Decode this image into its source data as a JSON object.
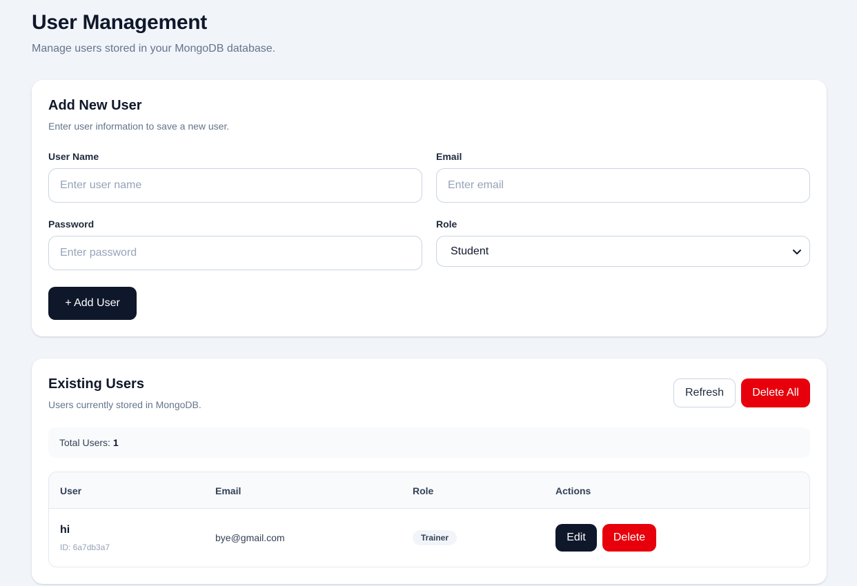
{
  "header": {
    "title": "User Management",
    "subtitle": "Manage users stored in your MongoDB database."
  },
  "add_user": {
    "title": "Add New User",
    "description": "Enter user information to save a new user.",
    "fields": {
      "username": {
        "label": "User Name",
        "placeholder": "Enter user name",
        "value": ""
      },
      "email": {
        "label": "Email",
        "placeholder": "Enter email",
        "value": ""
      },
      "password": {
        "label": "Password",
        "placeholder": "Enter password",
        "value": ""
      },
      "role": {
        "label": "Role",
        "selected": "Student"
      }
    },
    "submit_label": "+ Add User"
  },
  "existing_users": {
    "title": "Existing Users",
    "description": "Users currently stored in MongoDB.",
    "refresh_label": "Refresh",
    "delete_all_label": "Delete All",
    "total_label": "Total Users:",
    "total_count": "1",
    "columns": [
      "User",
      "Email",
      "Role",
      "Actions"
    ],
    "rows": [
      {
        "name": "hi",
        "id": "ID: 6a7db3a7",
        "email": "bye@gmail.com",
        "role": "Trainer",
        "edit_label": "Edit",
        "delete_label": "Delete"
      }
    ]
  },
  "icons": {
    "role_select": "chevron-down-icon"
  },
  "colors": {
    "background": "#f1f4f9",
    "primary_dark": "#0f172a",
    "danger": "#e7000b",
    "muted_text": "#64748b"
  }
}
